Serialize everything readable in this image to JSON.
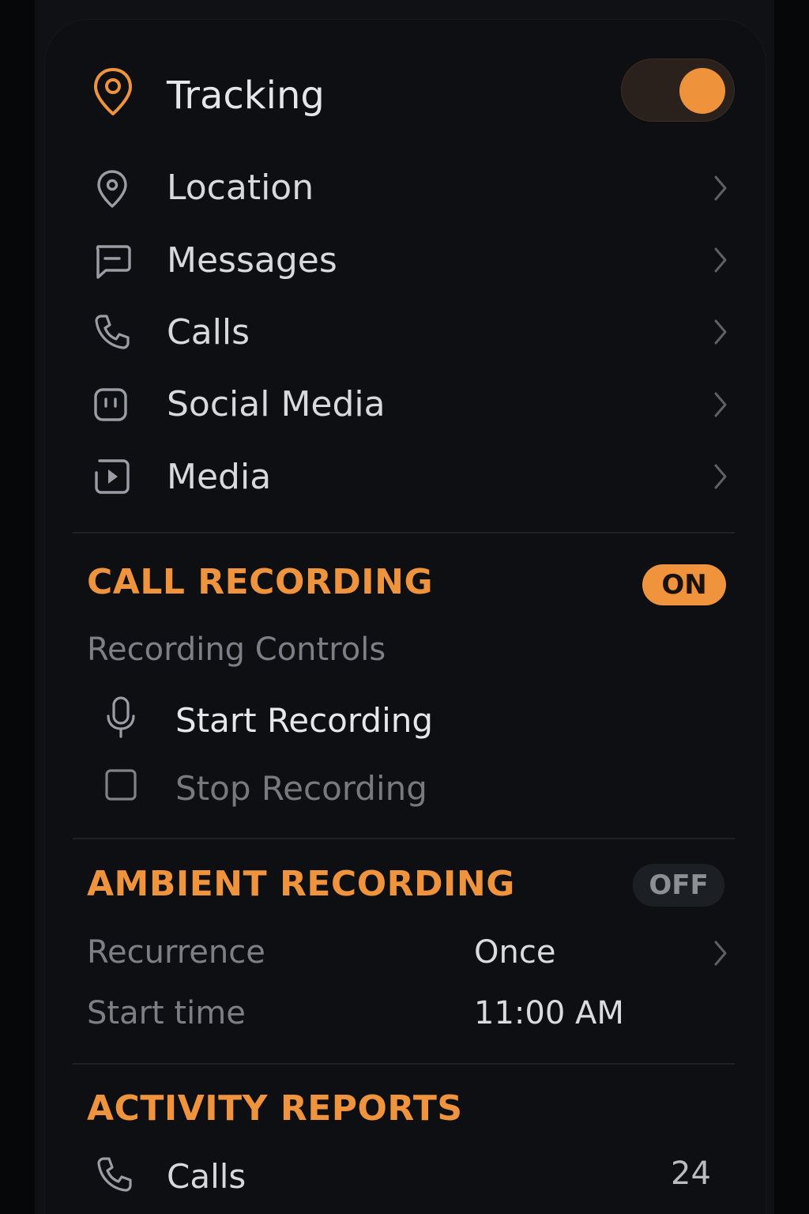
{
  "tracking": {
    "title": "Tracking",
    "enabled": true,
    "accent_color": "#ef933d"
  },
  "menu": {
    "items": [
      {
        "label": "Location",
        "icon": "location-pin-icon"
      },
      {
        "label": "Messages",
        "icon": "message-icon"
      },
      {
        "label": "Calls",
        "icon": "phone-icon"
      },
      {
        "label": "Social Media",
        "icon": "social-media-icon"
      },
      {
        "label": "Media",
        "icon": "media-play-icon"
      }
    ]
  },
  "call_recording": {
    "title": "CALL RECORDING",
    "status": "ON",
    "controls_label": "Recording Controls",
    "start_label": "Start Recording",
    "stop_label": "Stop Recording"
  },
  "ambient_recording": {
    "title": "AMBIENT RECORDING",
    "status": "OFF",
    "recurrence_label": "Recurrence",
    "recurrence_value": "Once",
    "start_time_label": "Start time",
    "start_time_value": "11:00 AM"
  },
  "activity_reports": {
    "title": "ACTIVITY REPORTS",
    "calls_label": "Calls",
    "calls_count": "24"
  }
}
